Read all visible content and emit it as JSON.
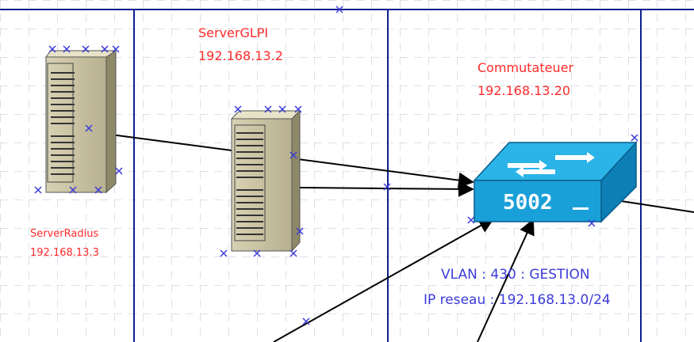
{
  "nodes": {
    "server_radius": {
      "name": "ServerRadius",
      "ip": "192.168.13.3"
    },
    "server_glpi": {
      "name": "ServerGLPI",
      "ip": "192.168.13.2"
    },
    "switch": {
      "name": "Commutateuer",
      "ip": "192.168.13.20",
      "model": "5002"
    }
  },
  "vlan": {
    "line1": "VLAN : 430 : GESTION",
    "line2": "IP reseau : 192.168.13.0/24"
  },
  "colors": {
    "label_red": "#ff2a2a",
    "label_blue": "#3b3bd9",
    "separator_blue": "#0b1f8f",
    "switch_blue": "#1aa0d8",
    "server_body": "#c7c1a2"
  }
}
